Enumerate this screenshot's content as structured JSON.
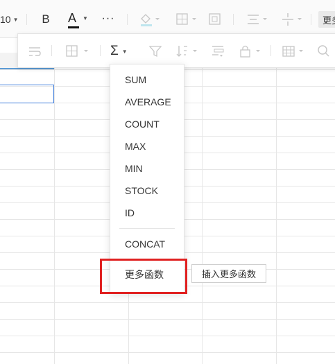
{
  "toolbar": {
    "font_size": "10",
    "bold_label": "B",
    "font_color_label": "A",
    "font_color_bar": "#111111",
    "more_label": "···",
    "more_functions_label": "更多"
  },
  "sub_toolbar": {
    "sum_label": "Σ"
  },
  "dropdown": {
    "items": [
      "SUM",
      "AVERAGE",
      "COUNT",
      "MAX",
      "MIN",
      "STOCK",
      "ID"
    ],
    "concat": "CONCAT",
    "more_functions": "更多函数",
    "tooltip": "插入更多函数"
  },
  "colors": {
    "selection_border": "#3d7cdb",
    "highlight_box": "#e02020"
  }
}
